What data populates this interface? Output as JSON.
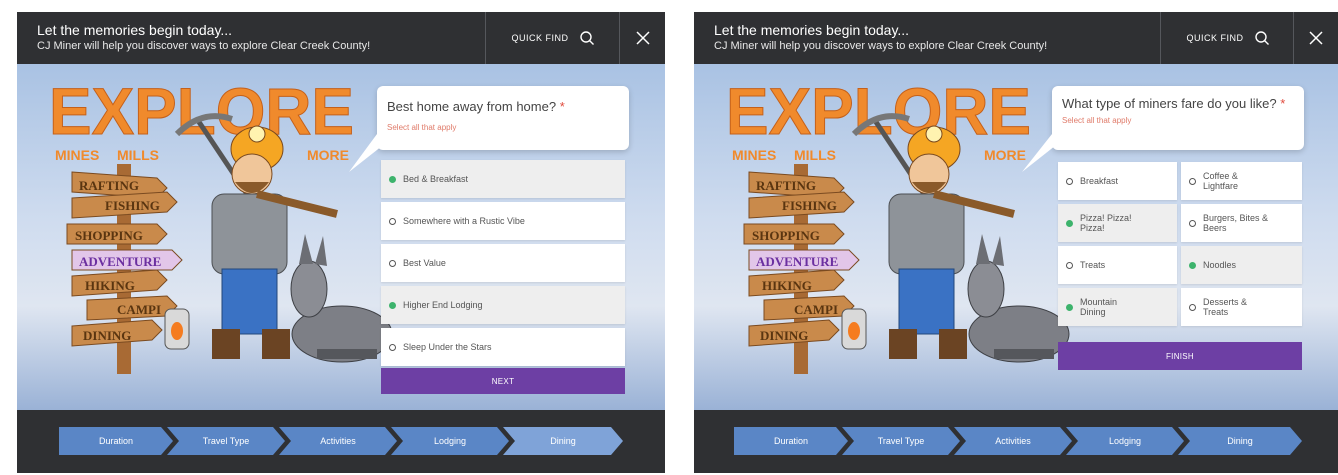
{
  "panels": [
    {
      "header": {
        "title": "Let the memories begin today...",
        "subtitle": "CJ Miner will help you discover ways to explore Clear Creek County!",
        "quick_find_label": "QUICK FIND"
      },
      "art": {
        "headline": "EXPLORE",
        "subline_left": "MINES",
        "subline_mid": "MILLS",
        "subline_right": "MORE",
        "signs": [
          "RAFTING",
          "FISHING",
          "SHOPPING",
          "ADVENTURE",
          "HIKING",
          "CAMPI",
          "DINING"
        ]
      },
      "question": {
        "text": "Best home away from home?",
        "required_mark": "*",
        "hint": "Select all that apply"
      },
      "options": [
        {
          "label": "Bed & Breakfast",
          "selected": true
        },
        {
          "label": "Somewhere with a Rustic Vibe",
          "selected": false
        },
        {
          "label": "Best Value",
          "selected": false
        },
        {
          "label": "Higher End Lodging",
          "selected": true
        },
        {
          "label": "Sleep Under the Stars",
          "selected": false
        }
      ],
      "cta_label": "NEXT",
      "steps": [
        "Duration",
        "Travel Type",
        "Activities",
        "Lodging",
        "Dining"
      ],
      "active_step": "Dining"
    },
    {
      "header": {
        "title": "Let the memories begin today...",
        "subtitle": "CJ Miner will help you discover ways to explore Clear Creek County!",
        "quick_find_label": "QUICK FIND"
      },
      "art": {
        "headline": "EXPLORE",
        "subline_left": "MINES",
        "subline_mid": "MILLS",
        "subline_right": "MORE",
        "signs": [
          "RAFTING",
          "FISHING",
          "SHOPPING",
          "ADVENTURE",
          "HIKING",
          "CAMPI",
          "DINING"
        ]
      },
      "question": {
        "text": "What type of miners fare do you like?",
        "required_mark": "*",
        "hint": "Select all that apply"
      },
      "options": [
        {
          "label": "Breakfast",
          "selected": false
        },
        {
          "label": "Coffee & Lightfare",
          "selected": false
        },
        {
          "label": "Pizza! Pizza! Pizza!",
          "selected": true
        },
        {
          "label": "Burgers, Bites & Beers",
          "selected": false
        },
        {
          "label": "Treats",
          "selected": false
        },
        {
          "label": "Noodles",
          "selected": true
        },
        {
          "label": "Mountain Dining",
          "selected": true
        },
        {
          "label": "Desserts & Treats",
          "selected": false
        }
      ],
      "cta_label": "FINISH",
      "steps": [
        "Duration",
        "Travel Type",
        "Activities",
        "Lodging",
        "Dining"
      ],
      "active_step": "Dining"
    }
  ],
  "colors": {
    "header_bg": "#2f3033",
    "cta_purple": "#6d3fa4",
    "step_blue": "#5a86c6",
    "step_active": "#7fa3d8",
    "selected_dot": "#3db36c",
    "explore_orange": "#f08a2c"
  },
  "icons": [
    "search-icon",
    "close-icon",
    "miner-illustration",
    "donkey-illustration",
    "signpost-illustration"
  ]
}
